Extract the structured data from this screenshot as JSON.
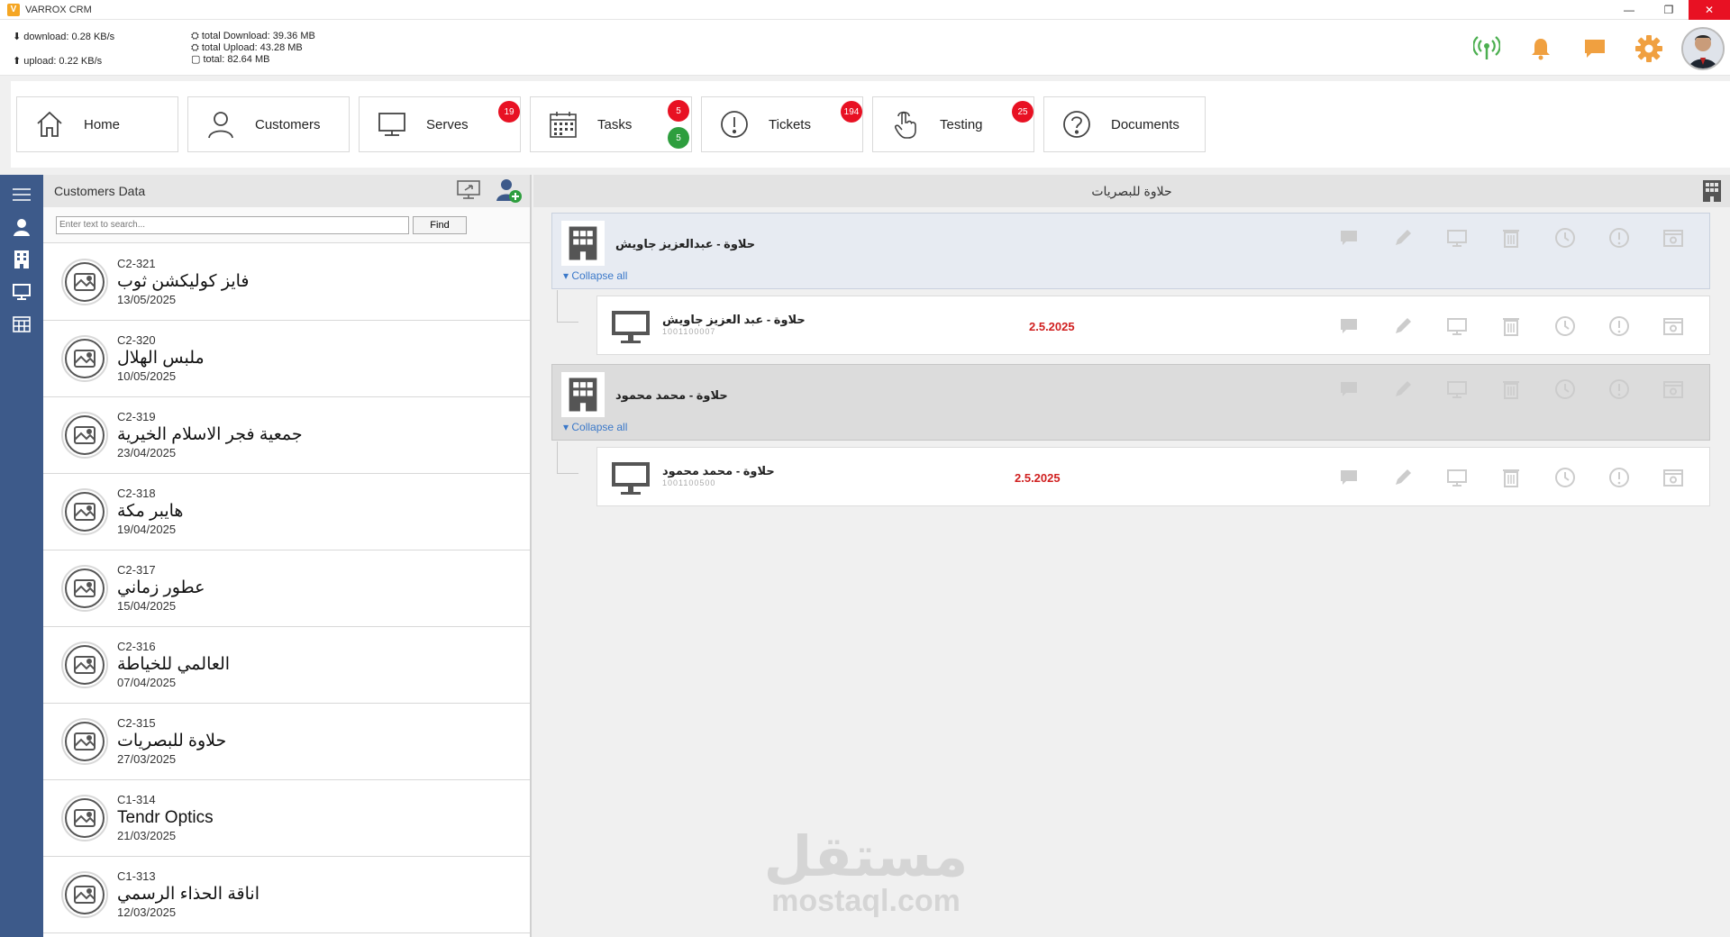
{
  "window": {
    "title": "VARROX CRM",
    "controls": {
      "minimize": "—",
      "restore": "❐",
      "close": "✕"
    }
  },
  "network": {
    "download": "download: 0.28 KB/s",
    "upload": "upload: 0.22 KB/s",
    "total_download": "total Download: 39.36 MB",
    "total_upload": "total Upload: 43.28 MB",
    "total": "total: 82.64 MB"
  },
  "header_icons": [
    "antenna-icon",
    "bell-icon",
    "chat-icon",
    "gear-icon",
    "user-avatar"
  ],
  "nav": [
    {
      "label": "Home",
      "icon": "home-icon",
      "badges": []
    },
    {
      "label": "Customers",
      "icon": "person-icon",
      "badges": []
    },
    {
      "label": "Serves",
      "icon": "monitor-icon",
      "badges": [
        "19"
      ]
    },
    {
      "label": "Tasks",
      "icon": "calendar-icon",
      "badges": [
        "5",
        "5"
      ]
    },
    {
      "label": "Tickets",
      "icon": "alert-icon",
      "badges": [
        "194"
      ]
    },
    {
      "label": "Testing",
      "icon": "touch-icon",
      "badges": [
        "25"
      ]
    },
    {
      "label": "Documents",
      "icon": "help-icon",
      "badges": []
    }
  ],
  "customers_panel": {
    "title": "Customers Data",
    "search": {
      "placeholder": "Enter text to search...",
      "button": "Find"
    },
    "items": [
      {
        "code": "C2-321",
        "name": "فايز كوليكشن ثوب",
        "date": "13/05/2025"
      },
      {
        "code": "C2-320",
        "name": "ملبس الهلال",
        "date": "10/05/2025"
      },
      {
        "code": "C2-319",
        "name": "جمعية فجر الاسلام الخيرية",
        "date": "23/04/2025"
      },
      {
        "code": "C2-318",
        "name": "هايبر مكة",
        "date": "19/04/2025"
      },
      {
        "code": "C2-317",
        "name": "عطور زماني",
        "date": "15/04/2025"
      },
      {
        "code": "C2-316",
        "name": "العالمي للخياطة",
        "date": "07/04/2025"
      },
      {
        "code": "C2-315",
        "name": "حلاوة للبصريات",
        "date": "27/03/2025"
      },
      {
        "code": "C1-314",
        "name": "Tendr Optics",
        "date": "21/03/2025"
      },
      {
        "code": "C1-313",
        "name": "اناقة الحذاء الرسمي",
        "date": "12/03/2025"
      }
    ]
  },
  "detail_panel": {
    "title": "حلاوة للبصريات",
    "groups": [
      {
        "name": "حلاوة - عبدالعزيز جاويش",
        "collapse": "Collapse all",
        "device": {
          "name": "حلاوة - عبد العزيز جاويش",
          "serial": "1001100007",
          "date": "2.5.2025"
        }
      },
      {
        "name": "حلاوة - محمد محمود",
        "collapse": "Collapse all",
        "device": {
          "name": "حلاوة - محمد محمود",
          "serial": "1001100500",
          "date": "2.5.2025"
        }
      }
    ]
  },
  "watermark": {
    "arabic": "مستقل",
    "latin": "mostaql.com"
  },
  "colors": {
    "rail": "#3d5a8a",
    "badge_red": "#e81123",
    "badge_green": "#2e9e3e",
    "accent_orange": "#f0a040",
    "link_blue": "#3a78c9",
    "date_red": "#d02020"
  }
}
